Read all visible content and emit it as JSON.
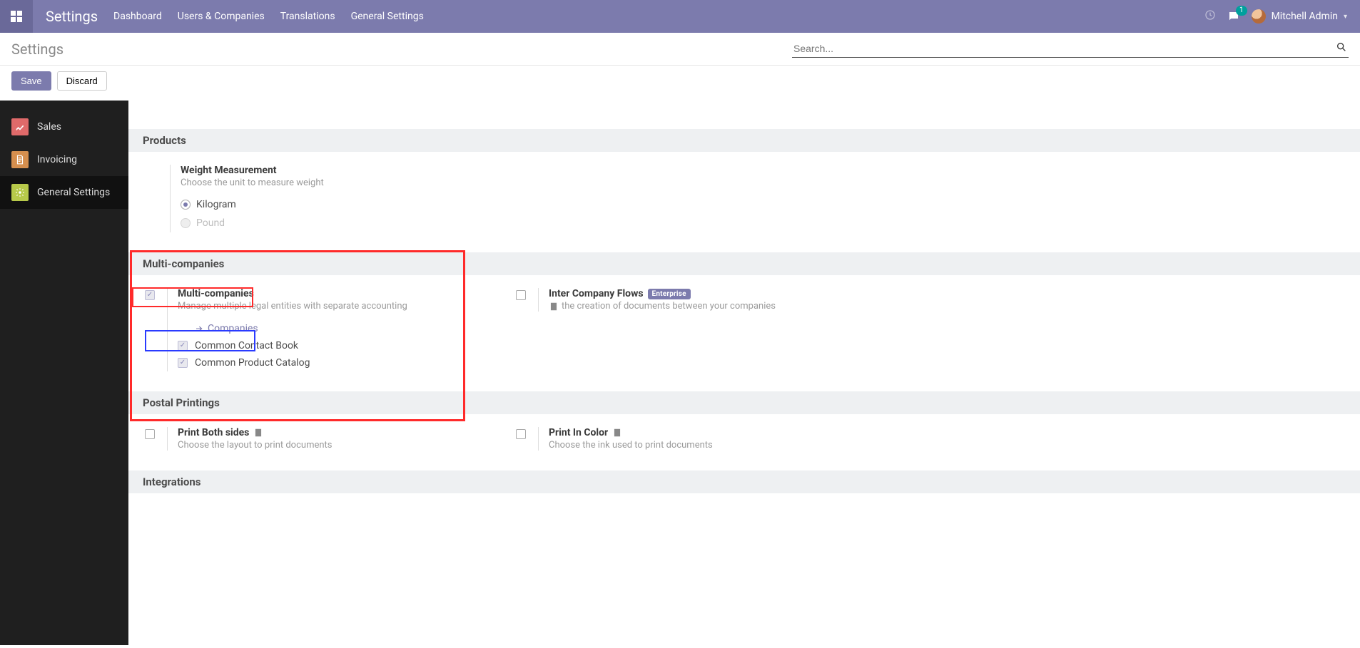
{
  "topnav": {
    "app_name": "Settings",
    "menu": [
      "Dashboard",
      "Users & Companies",
      "Translations",
      "General Settings"
    ],
    "chat_badge": "1",
    "user_name": "Mitchell Admin"
  },
  "ctrlbar": {
    "title": "Settings",
    "search_placeholder": "Search...",
    "save": "Save",
    "discard": "Discard"
  },
  "sidebar": {
    "items": [
      {
        "label": "Sales"
      },
      {
        "label": "Invoicing"
      },
      {
        "label": "General Settings"
      }
    ]
  },
  "sections": {
    "products": {
      "header": "Products",
      "weight": {
        "title": "Weight Measurement",
        "desc": "Choose the unit to measure weight",
        "opt_kg": "Kilogram",
        "opt_lb": "Pound"
      }
    },
    "multi": {
      "header": "Multi-companies",
      "multi_title": "Multi-companies",
      "multi_desc": "Manage multiple legal entities with separate accounting",
      "companies_link": "Companies",
      "common_contact": "Common Contact Book",
      "common_product": "Common Product Catalog",
      "inter_title": "Inter Company Flows",
      "enterprise": "Enterprise",
      "inter_desc": "the creation of documents between your companies"
    },
    "postal": {
      "header": "Postal Printings",
      "print_both_title": "Print Both sides",
      "print_both_desc": "Choose the layout to print documents",
      "print_color_title": "Print In Color",
      "print_color_desc": "Choose the ink used to print documents"
    },
    "integrations": {
      "header": "Integrations"
    }
  }
}
